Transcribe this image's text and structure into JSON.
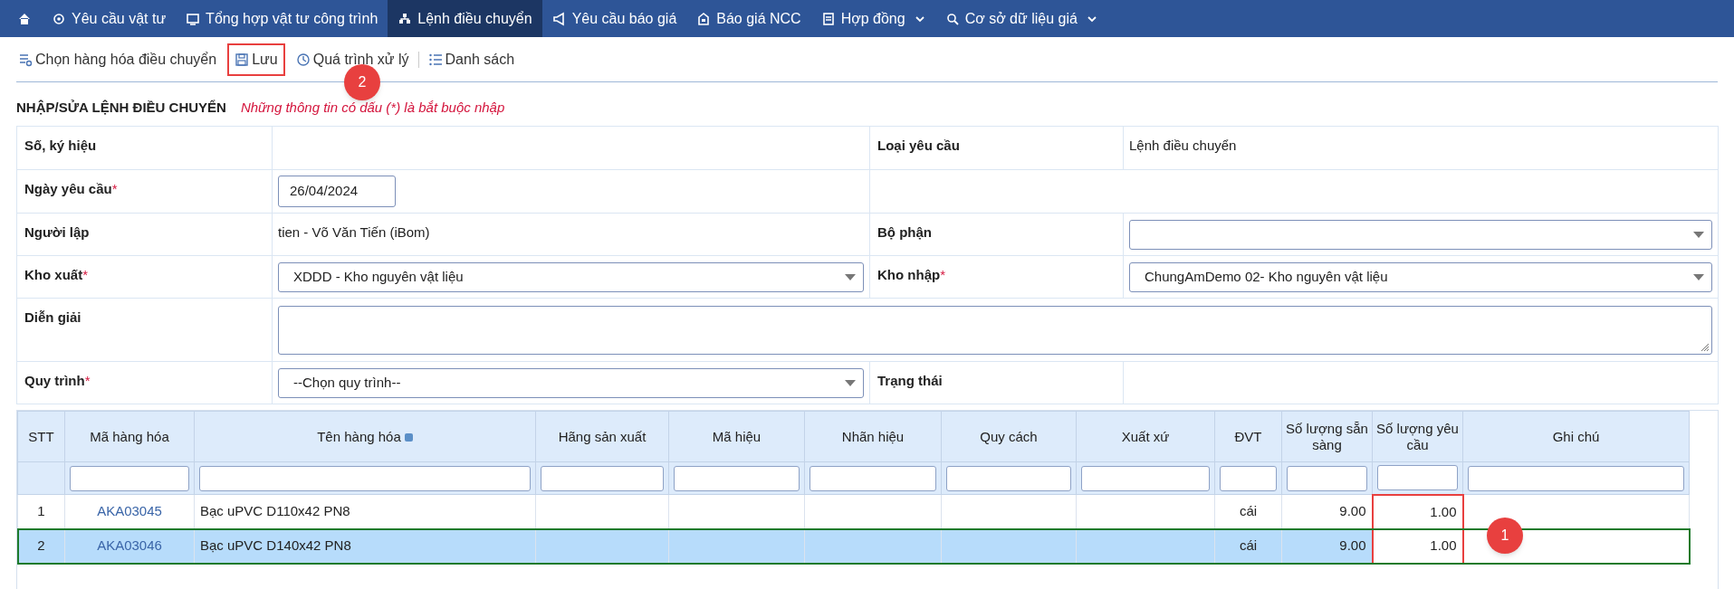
{
  "nav": [
    {
      "kind": "home",
      "selected": false
    },
    {
      "kind": "link",
      "label": "Yêu cầu vật tư",
      "selected": false
    },
    {
      "kind": "link",
      "label": "Tổng hợp vật tư công trình",
      "selected": false
    },
    {
      "kind": "link",
      "label": "Lệnh điều chuyển",
      "selected": true
    },
    {
      "kind": "link",
      "label": "Yêu cầu báo giá",
      "selected": false
    },
    {
      "kind": "link",
      "label": "Báo giá NCC",
      "selected": false
    },
    {
      "kind": "dropdown",
      "label": "Hợp đồng",
      "selected": false
    },
    {
      "kind": "dropdown",
      "label": "Cơ sở dữ liệu giá",
      "selected": false
    }
  ],
  "toolbar": [
    {
      "label": "Chọn hàng hóa điều chuyển"
    },
    {
      "label": "Lưu",
      "callout": "2"
    },
    {
      "label": "Quá trình xử lý"
    },
    {
      "label": "Danh sách"
    }
  ],
  "form": {
    "title": "NHẬP/SỬA LỆNH ĐIỀU CHUYỂN",
    "note": "Những thông tin có dấu (*) là bắt buộc nhập",
    "rows": [
      {
        "fields": [
          {
            "label": "Số, ký hiệu",
            "kind": "empty"
          },
          {
            "label": "Loại yêu cầu",
            "kind": "text",
            "value": "Lệnh điều chuyển"
          }
        ]
      },
      {
        "fields": [
          {
            "label": "Ngày yêu cầu",
            "mark": "*",
            "kind": "date",
            "value": "26/04/2024"
          },
          {
            "kind": "blank"
          }
        ]
      },
      {
        "fields": [
          {
            "label": "Người lập",
            "kind": "text",
            "value": "tien - Võ Văn Tiến (iBom)"
          },
          {
            "label": "Bộ phận",
            "kind": "select"
          }
        ]
      },
      {
        "fields": [
          {
            "label": "Kho xuất",
            "mark": "*",
            "kind": "select",
            "value": "XDDD - Kho nguyên vật liệu"
          },
          {
            "label": "Kho nhập",
            "mark": "*",
            "kind": "select",
            "value": "ChungAmDemo 02- Kho nguyên vật liệu"
          }
        ]
      },
      {
        "fields": [
          {
            "label": "Diễn giải",
            "kind": "textarea"
          }
        ]
      },
      {
        "fields": [
          {
            "label": "Quy trình",
            "mark": "*",
            "kind": "select",
            "value": "--Chọn quy trình--"
          },
          {
            "label": "Trạng thái",
            "kind": "empty"
          }
        ]
      }
    ]
  },
  "grid": {
    "columns": [
      {
        "label": "STT",
        "filter": false
      },
      {
        "label": "Mã hàng hóa",
        "filter": true
      },
      {
        "label": "Tên hàng hóa",
        "filter": true,
        "icon": true
      },
      {
        "label": "Hãng sản xuất",
        "filter": true
      },
      {
        "label": "Mã hiệu",
        "filter": true
      },
      {
        "label": "Nhãn hiệu",
        "filter": true
      },
      {
        "label": "Quy cách",
        "filter": true
      },
      {
        "label": "Xuất xứ",
        "filter": true
      },
      {
        "label": "ĐVT",
        "filter": true
      },
      {
        "label": "Số lượng sẵn sàng",
        "filter": true
      },
      {
        "label": "Số lượng yêu cầu",
        "filter": true,
        "callout": "1"
      },
      {
        "label": "Ghi chú",
        "filter": true
      }
    ],
    "rows": [
      {
        "selected": false,
        "cells": [
          "1",
          "AKA03045",
          "Bạc uPVC D110x42 PN8",
          null,
          null,
          null,
          null,
          null,
          "cái",
          "9.00",
          "1.00",
          null
        ]
      },
      {
        "selected": true,
        "cells": [
          "2",
          "AKA03046",
          "Bạc uPVC D140x42 PN8",
          null,
          null,
          null,
          null,
          null,
          "cái",
          "9.00",
          "1.00",
          null
        ]
      }
    ]
  }
}
